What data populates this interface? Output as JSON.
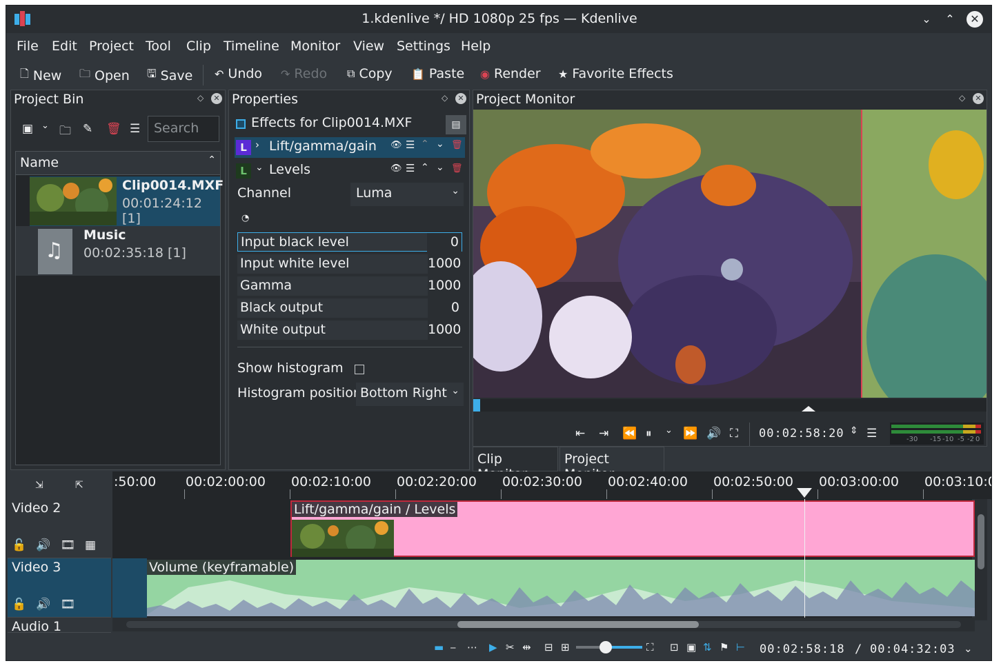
{
  "window": {
    "title": "1.kdenlive */ HD 1080p 25 fps — Kdenlive"
  },
  "menu": [
    "File",
    "Edit",
    "Project",
    "Tool",
    "Clip",
    "Timeline",
    "Monitor",
    "View",
    "Settings",
    "Help"
  ],
  "toolbar": {
    "new": "New",
    "open": "Open",
    "save": "Save",
    "undo": "Undo",
    "redo": "Redo",
    "copy": "Copy",
    "paste": "Paste",
    "render": "Render",
    "favorite_effects": "Favorite Effects"
  },
  "project_bin": {
    "title": "Project Bin",
    "search_placeholder": "Search",
    "column_name": "Name",
    "items": [
      {
        "name": "Clip0014.MXF",
        "duration": "00:01:24:12 [1]"
      },
      {
        "name": "Music",
        "duration": "00:02:35:18 [1]"
      }
    ]
  },
  "properties": {
    "title": "Properties",
    "effects_for": "Effects for Clip0014.MXF",
    "effects": [
      {
        "badge": "L",
        "name": "Lift/gamma/gain"
      },
      {
        "badge": "L",
        "name": "Levels"
      }
    ],
    "channel_label": "Channel",
    "channel_value": "Luma",
    "params": [
      {
        "label": "Input black level",
        "value": "0"
      },
      {
        "label": "Input white level",
        "value": "1000"
      },
      {
        "label": "Gamma",
        "value": "1000"
      },
      {
        "label": "Black output",
        "value": "0"
      },
      {
        "label": "White output",
        "value": "1000"
      }
    ],
    "show_histogram_label": "Show histogram",
    "histogram_position_label": "Histogram position",
    "histogram_position_value": "Bottom Right"
  },
  "monitor": {
    "title": "Project Monitor",
    "timecode": "00:02:58:20",
    "meter_labels": [
      "-30",
      "-15",
      "-10",
      "-5",
      "-2",
      "0"
    ],
    "tabs": [
      "Clip Monitor",
      "Project Monitor"
    ]
  },
  "timeline": {
    "ruler": [
      ":50:00",
      "00:02:00:00",
      "00:02:10:00",
      "00:02:20:00",
      "00:02:30:00",
      "00:02:40:00",
      "00:02:50:00",
      "00:03:00:00",
      "00:03:10:0"
    ],
    "tracks": [
      {
        "name": "Video 2",
        "clip_label": "Lift/gamma/gain / Levels"
      },
      {
        "name": "Video 3",
        "clip_label": "Volume (keyframable)"
      },
      {
        "name": "Audio 1"
      }
    ],
    "position": "00:02:58:18",
    "duration_sep": "/",
    "duration": "00:04:32:03"
  },
  "colors": {
    "accent": "#3daee9",
    "video_clip": "#ffa6d4",
    "audio_clip": "#95d5a2",
    "selection": "#1d4b66"
  }
}
